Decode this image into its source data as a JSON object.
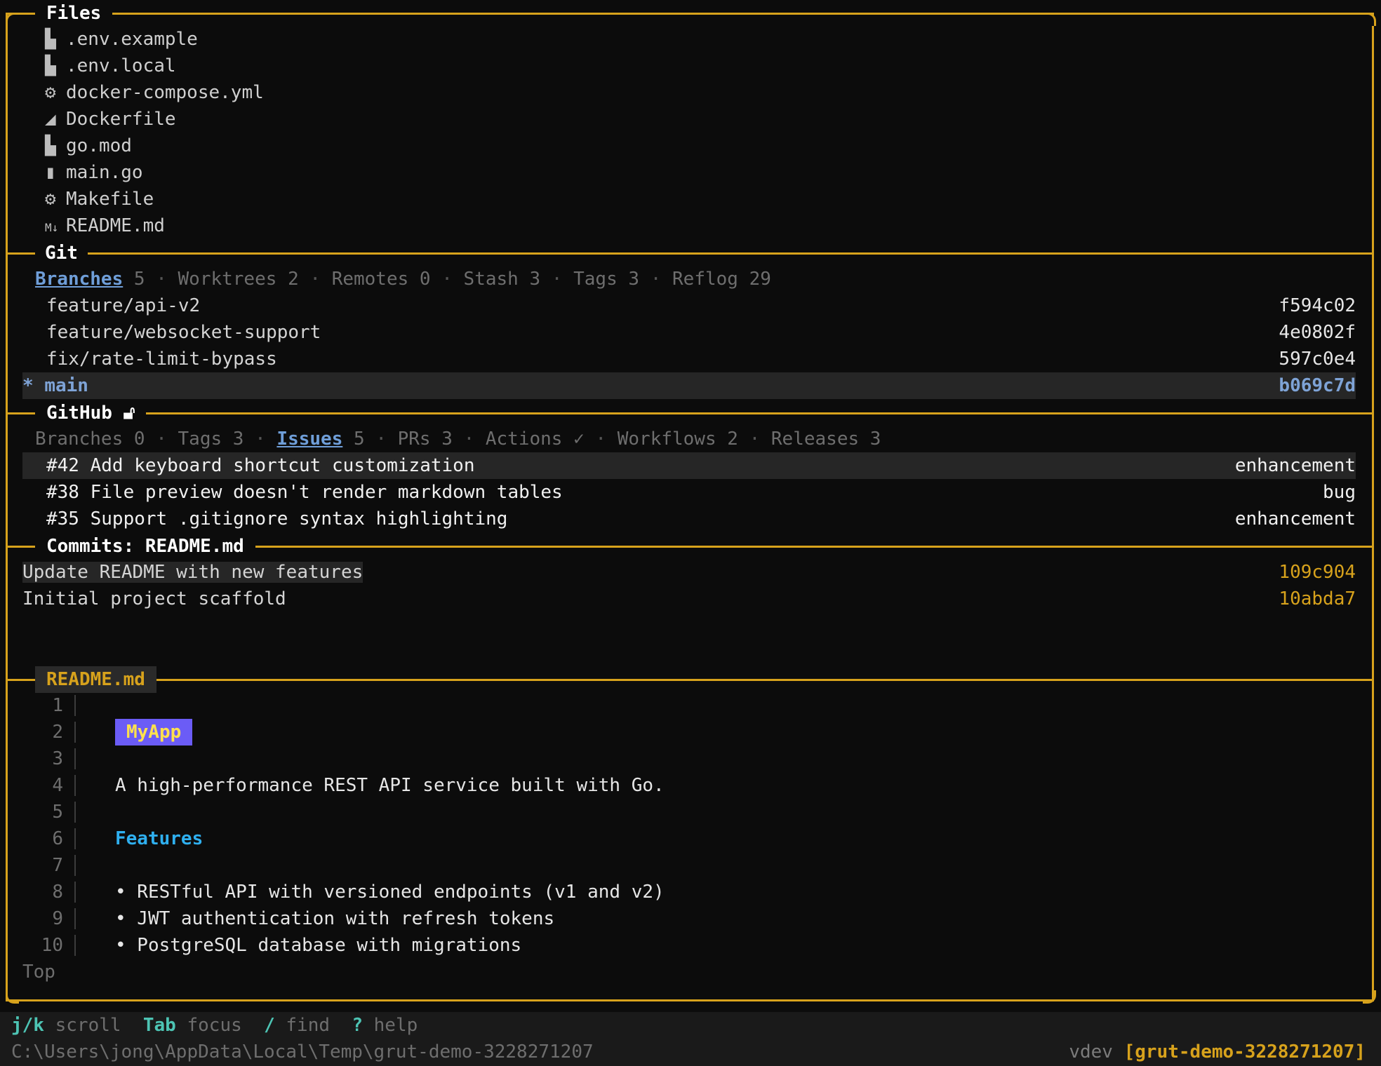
{
  "files": {
    "title": "Files",
    "items": [
      {
        "name": ".env.example",
        "icon": "file-icon"
      },
      {
        "name": ".env.local",
        "icon": "file-icon"
      },
      {
        "name": "docker-compose.yml",
        "icon": "gear-icon"
      },
      {
        "name": "Dockerfile",
        "icon": "docker-icon"
      },
      {
        "name": "go.mod",
        "icon": "file-icon"
      },
      {
        "name": "main.go",
        "icon": "go-file-icon"
      },
      {
        "name": "Makefile",
        "icon": "gear-icon"
      },
      {
        "name": "README.md",
        "icon": "markdown-icon"
      }
    ]
  },
  "git": {
    "title": "Git",
    "tabs": [
      {
        "label": "Branches",
        "count": "5"
      },
      {
        "label": "Worktrees",
        "count": "2"
      },
      {
        "label": "Remotes",
        "count": "0"
      },
      {
        "label": "Stash",
        "count": "3"
      },
      {
        "label": "Tags",
        "count": "3"
      },
      {
        "label": "Reflog",
        "count": "29"
      }
    ],
    "branches": [
      {
        "name": "feature/api-v2",
        "hash": "f594c02"
      },
      {
        "name": "feature/websocket-support",
        "hash": "4e0802f"
      },
      {
        "name": "fix/rate-limit-bypass",
        "hash": "597c0e4"
      },
      {
        "name": "main",
        "hash": "b069c7d",
        "marker": "*"
      }
    ]
  },
  "github": {
    "title": "GitHub",
    "tabs": [
      {
        "label": "Branches",
        "count": "0"
      },
      {
        "label": "Tags",
        "count": "3"
      },
      {
        "label": "Issues",
        "count": "5"
      },
      {
        "label": "PRs",
        "count": "3"
      },
      {
        "label": "Actions",
        "count": "✓"
      },
      {
        "label": "Workflows",
        "count": "2"
      },
      {
        "label": "Releases",
        "count": "3"
      }
    ],
    "issues": [
      {
        "text": "#42 Add keyboard shortcut customization",
        "label": "enhancement"
      },
      {
        "text": "#38 File preview doesn't render markdown tables",
        "label": "bug"
      },
      {
        "text": "#35 Support .gitignore syntax highlighting",
        "label": "enhancement"
      }
    ]
  },
  "commits": {
    "title": "Commits: README.md",
    "items": [
      {
        "message": "Update README with new features",
        "hash": "109c904"
      },
      {
        "message": "Initial project scaffold",
        "hash": "10abda7"
      }
    ]
  },
  "preview": {
    "title": "README.md",
    "lines": [
      "1",
      "2",
      "3",
      "4",
      "5",
      "6",
      "7",
      "8",
      "9",
      "10"
    ],
    "heading": "MyApp",
    "description": "A high-performance REST API service built with Go.",
    "features_heading": "Features",
    "bullets": [
      "• RESTful API with versioned endpoints (v1 and v2)",
      "• JWT authentication with refresh tokens",
      "• PostgreSQL database with migrations"
    ],
    "position": "Top"
  },
  "statusbar": {
    "hints": [
      {
        "key": "j/k",
        "desc": "scroll"
      },
      {
        "key": "Tab",
        "desc": "focus"
      },
      {
        "key": "/",
        "desc": "find"
      },
      {
        "key": "?",
        "desc": "help"
      }
    ],
    "path": "C:\\Users\\jong\\AppData\\Local\\Temp\\grut-demo-3228271207",
    "version": "vdev",
    "repo": "[grut-demo-3228271207]"
  },
  "colors": {
    "accent": "#d7a21c",
    "link": "#6f9ed8",
    "badge": "#6b5cf6",
    "heading": "#2fb0f0"
  }
}
